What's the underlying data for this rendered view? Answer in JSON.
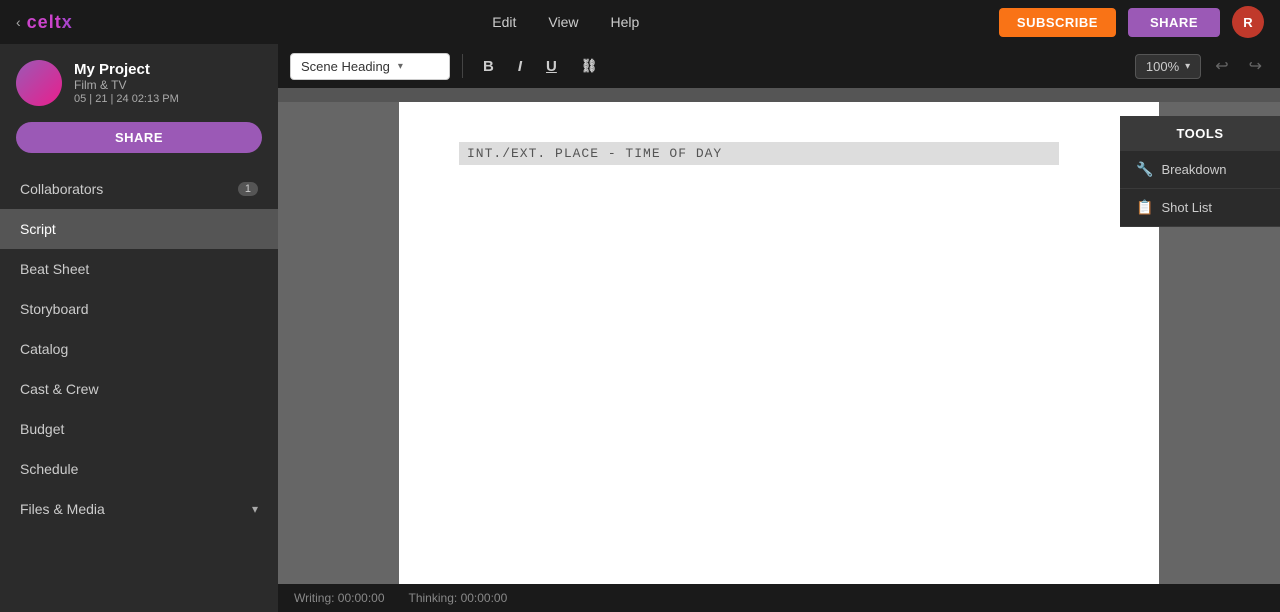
{
  "app": {
    "logo_arrow": "‹",
    "logo_prefix": "celt",
    "logo_suffix": "x"
  },
  "topnav": {
    "edit_label": "Edit",
    "view_label": "View",
    "help_label": "Help",
    "subscribe_label": "SUBSCRIBE",
    "share_label": "SHARE",
    "avatar_initials": "R"
  },
  "sidebar": {
    "project_name": "My Project",
    "project_type": "Film & TV",
    "project_date": "05 | 21 | 24 02:13 PM",
    "share_button": "SHARE",
    "collaborators_label": "Collaborators",
    "collaborators_count": "1",
    "script_label": "Script",
    "beat_sheet_label": "Beat Sheet",
    "storyboard_label": "Storyboard",
    "catalog_label": "Catalog",
    "cast_crew_label": "Cast & Crew",
    "budget_label": "Budget",
    "schedule_label": "Schedule",
    "files_media_label": "Files & Media"
  },
  "toolbar": {
    "scene_heading": "Scene Heading",
    "bold_label": "B",
    "italic_label": "I",
    "underline_label": "U",
    "link_label": "⛓",
    "zoom_value": "100%"
  },
  "editor": {
    "scene_text": "INT./EXT. PLACE - TIME OF DAY"
  },
  "tools_panel": {
    "title": "TOOLS",
    "breakdown_label": "Breakdown",
    "shot_list_label": "Shot List"
  },
  "statusbar": {
    "writing_label": "Writing:",
    "writing_time": "00:00:00",
    "thinking_label": "Thinking:",
    "thinking_time": "00:00:00"
  }
}
